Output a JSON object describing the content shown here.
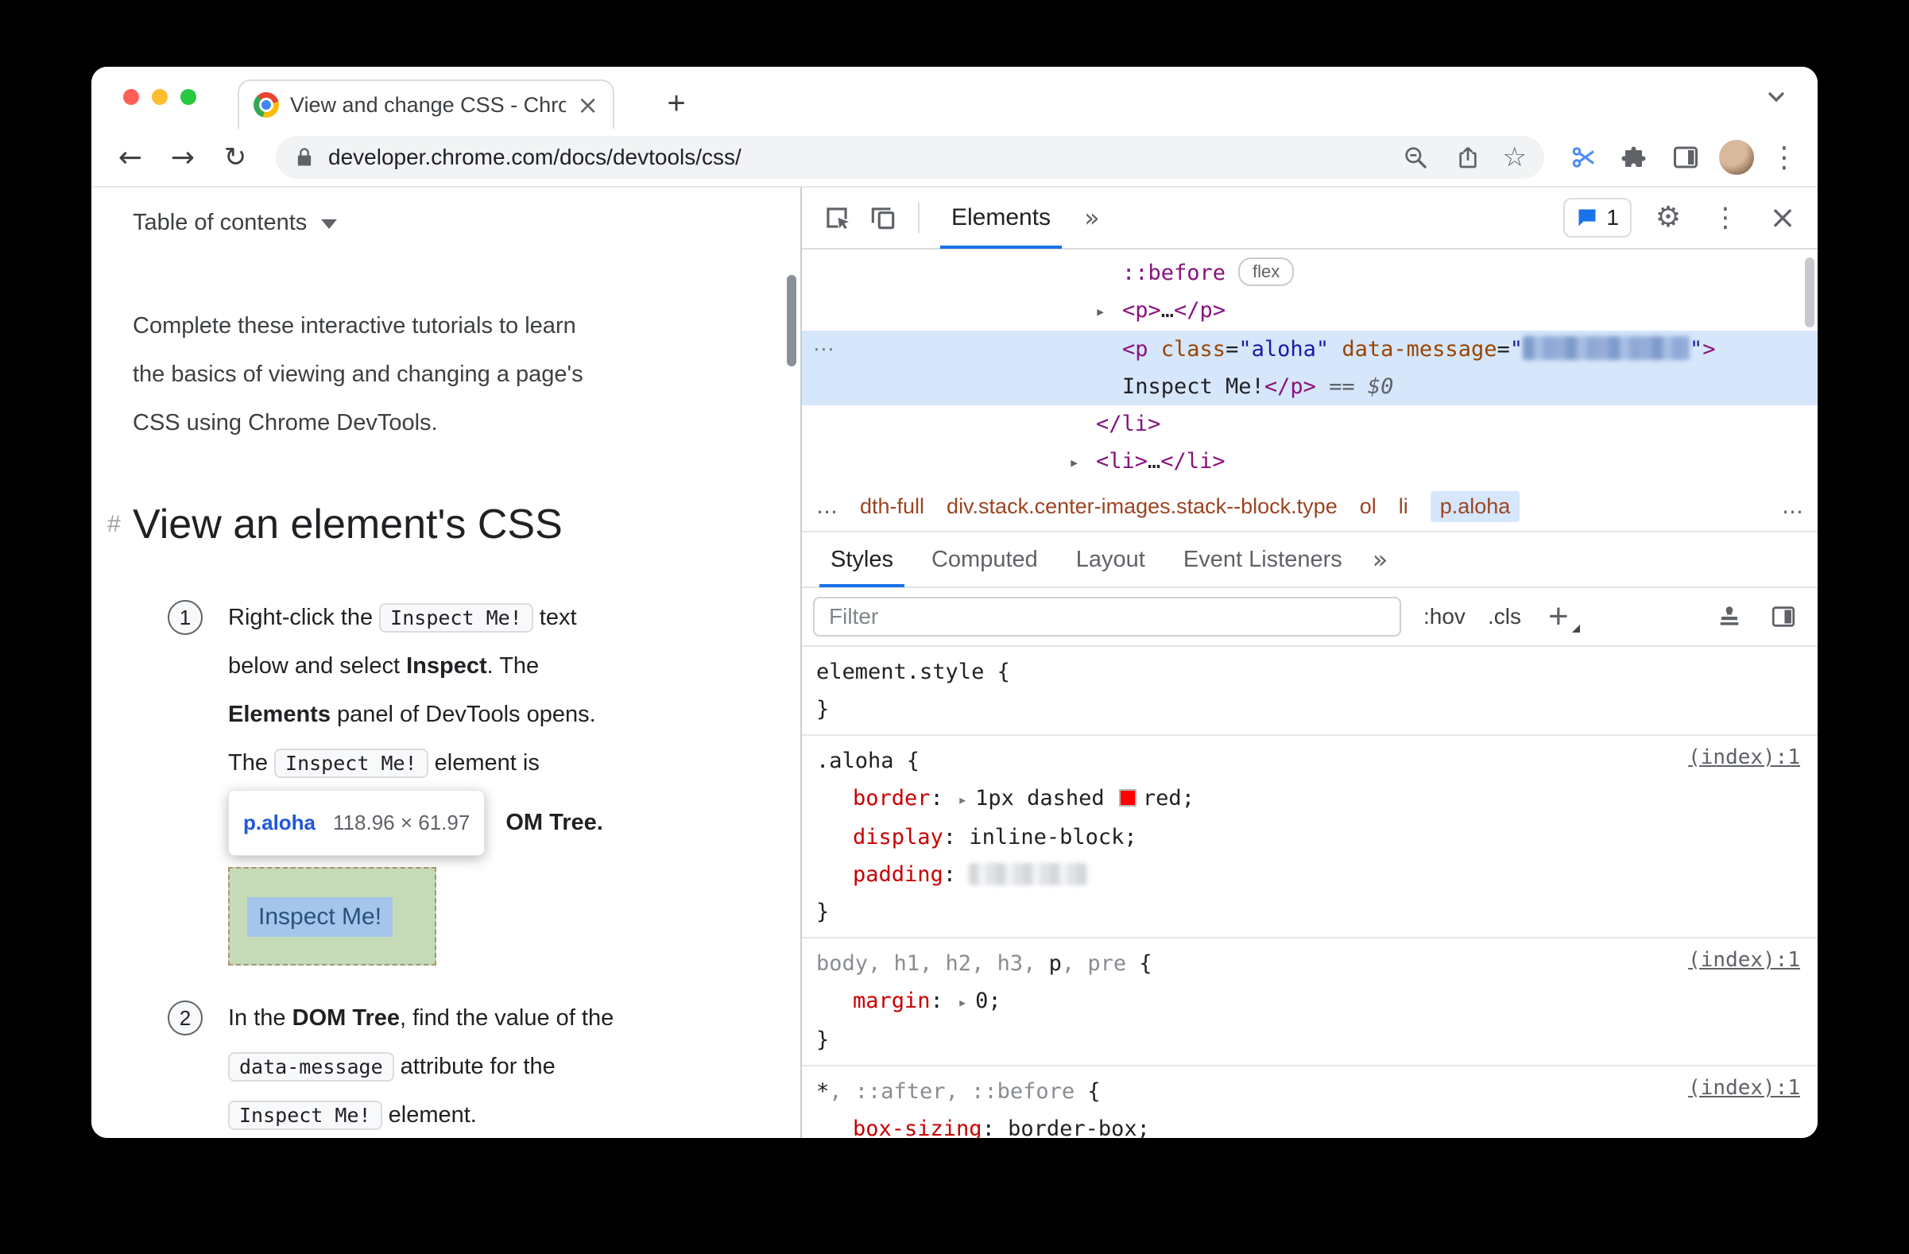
{
  "browser": {
    "tab_title": "View and change CSS - Chrom",
    "url": "developer.chrome.com/docs/devtools/css/",
    "icons": {
      "back": "←",
      "forward": "→",
      "reload": "↻",
      "star": "☆",
      "tab_close": "×",
      "new_tab": "+",
      "menu": "⋮"
    }
  },
  "docs": {
    "toc_label": "Table of contents",
    "intro_lines": [
      "Complete these interactive tutorials to learn",
      "the basics of viewing and changing a page's",
      "CSS using Chrome DevTools."
    ],
    "heading_anchor": "#",
    "heading": "View an element's CSS",
    "steps": {
      "one": {
        "num": "1",
        "lines": [
          [
            {
              "t": "text",
              "v": "Right-click the "
            },
            {
              "t": "code",
              "v": "Inspect Me!"
            },
            {
              "t": "text",
              "v": " text"
            }
          ],
          [
            {
              "t": "text",
              "v": "below and select "
            },
            {
              "t": "bold",
              "v": "Inspect"
            },
            {
              "t": "text",
              "v": ". The"
            }
          ],
          [
            {
              "t": "bold",
              "v": "Elements"
            },
            {
              "t": "text",
              "v": " panel of DevTools opens."
            }
          ],
          [
            {
              "t": "text",
              "v": "The "
            },
            {
              "t": "code",
              "v": "Inspect Me!"
            },
            {
              "t": "text",
              "v": " element is"
            }
          ]
        ],
        "tail": "OM Tree."
      },
      "two": {
        "num": "2",
        "lines": [
          [
            {
              "t": "text",
              "v": "In the "
            },
            {
              "t": "bold",
              "v": "DOM Tree"
            },
            {
              "t": "text",
              "v": ", find the value of the"
            }
          ],
          [
            {
              "t": "code",
              "v": "data-message"
            },
            {
              "t": "text",
              "v": " attribute for the"
            }
          ],
          [
            {
              "t": "code",
              "v": "Inspect Me!"
            },
            {
              "t": "text",
              "v": " element."
            }
          ]
        ]
      }
    },
    "tooltip": {
      "selector": "p.aloha",
      "size": "118.96 × 61.97"
    },
    "inspect_me_label": "Inspect Me!"
  },
  "devtools": {
    "toolbar": {
      "elements_tab": "Elements",
      "more": "»",
      "issues_count": "1",
      "gear": "⚙",
      "menu": "⋮",
      "close": "×"
    },
    "dom_rows": [
      {
        "level": 2,
        "tokens": [
          {
            "c": "pseudo",
            "v": "::before"
          },
          {
            "c": "badge",
            "v": "flex"
          }
        ]
      },
      {
        "level": 2,
        "arrow": "▸",
        "tokens": [
          {
            "c": "tag",
            "v": "<p>"
          },
          {
            "c": "plain",
            "v": "…"
          },
          {
            "c": "tag",
            "v": "</p>"
          }
        ]
      },
      {
        "level": 2,
        "selected": true,
        "gutter": "⋯",
        "tokens": [
          {
            "c": "tag",
            "v": "<p "
          },
          {
            "c": "attr",
            "v": "class"
          },
          {
            "c": "plain",
            "v": "="
          },
          {
            "c": "val",
            "v": "\"aloha\""
          },
          {
            "c": "plain",
            "v": " "
          },
          {
            "c": "attr",
            "v": "data-message"
          },
          {
            "c": "plain",
            "v": "="
          },
          {
            "c": "val",
            "v": "\""
          },
          {
            "c": "redact-blue",
            "v": ""
          },
          {
            "c": "val",
            "v": "\""
          },
          {
            "c": "tag",
            "v": ">"
          }
        ],
        "tokens2": [
          {
            "c": "text",
            "v": "Inspect Me!"
          },
          {
            "c": "tag",
            "v": "</p>"
          },
          {
            "c": "dim",
            "v": " == "
          },
          {
            "c": "dim-italic",
            "v": "$0"
          }
        ]
      },
      {
        "level": 1,
        "tokens": [
          {
            "c": "tag",
            "v": "</li>"
          }
        ]
      },
      {
        "level": 1,
        "arrow": "▸",
        "tokens": [
          {
            "c": "tag",
            "v": "<li>"
          },
          {
            "c": "plain",
            "v": "…"
          },
          {
            "c": "tag",
            "v": "</li>"
          }
        ]
      }
    ],
    "breadcrumbs": {
      "lead": "…",
      "items": [
        {
          "label": "dth-full"
        },
        {
          "label": "div.stack.center-images.stack--block.type"
        },
        {
          "label": "ol"
        },
        {
          "label": "li"
        },
        {
          "label": "p.aloha",
          "selected": true
        }
      ],
      "trail": "…"
    },
    "style_tabs": [
      {
        "label": "Styles",
        "active": true
      },
      {
        "label": "Computed"
      },
      {
        "label": "Layout"
      },
      {
        "label": "Event Listeners"
      }
    ],
    "style_tabs_more": "»",
    "filter": {
      "placeholder": "Filter",
      "hov_label": ":hov",
      "cls_label": ".cls",
      "plus": "+"
    },
    "style_sections": [
      {
        "lines": [
          {
            "tokens": [
              {
                "c": "sel",
                "v": "element.style"
              },
              {
                "c": "plain",
                "v": " {"
              }
            ]
          },
          {
            "tokens": [
              {
                "c": "plain",
                "v": "}"
              }
            ]
          }
        ]
      },
      {
        "link": "(index):1",
        "lines": [
          {
            "tokens": [
              {
                "c": "sel",
                "v": ".aloha"
              },
              {
                "c": "plain",
                "v": " {"
              }
            ]
          },
          {
            "prop": true,
            "tokens": [
              {
                "c": "prop",
                "v": "border"
              },
              {
                "c": "plain",
                "v": ": "
              },
              {
                "c": "exp",
                "v": "▸"
              },
              {
                "c": "plain",
                "v": "1px dashed "
              },
              {
                "c": "swatch",
                "v": ""
              },
              {
                "c": "plain",
                "v": "red;"
              }
            ]
          },
          {
            "prop": true,
            "tokens": [
              {
                "c": "prop",
                "v": "display"
              },
              {
                "c": "plain",
                "v": ": inline-block;"
              }
            ]
          },
          {
            "prop": true,
            "tokens": [
              {
                "c": "prop",
                "v": "padding"
              },
              {
                "c": "plain",
                "v": ": "
              },
              {
                "c": "redact-gray",
                "v": ""
              }
            ]
          },
          {
            "tokens": [
              {
                "c": "plain",
                "v": "}"
              }
            ]
          }
        ]
      },
      {
        "link": "(index):1",
        "lines": [
          {
            "tokens": [
              {
                "c": "dimsel",
                "v": "body, h1, h2, h3, "
              },
              {
                "c": "sel",
                "v": "p"
              },
              {
                "c": "dimsel",
                "v": ", pre"
              },
              {
                "c": "plain",
                "v": " {"
              }
            ]
          },
          {
            "prop": true,
            "tokens": [
              {
                "c": "prop",
                "v": "margin"
              },
              {
                "c": "plain",
                "v": ": "
              },
              {
                "c": "exp",
                "v": "▸"
              },
              {
                "c": "plain",
                "v": "0;"
              }
            ]
          },
          {
            "tokens": [
              {
                "c": "plain",
                "v": "}"
              }
            ]
          }
        ]
      },
      {
        "link": "(index):1",
        "lines": [
          {
            "tokens": [
              {
                "c": "sel",
                "v": "*"
              },
              {
                "c": "dimsel",
                "v": ", ::after, ::before"
              },
              {
                "c": "plain",
                "v": " {"
              }
            ]
          },
          {
            "prop": true,
            "tokens": [
              {
                "c": "prop",
                "v": "box-sizing"
              },
              {
                "c": "plain",
                "v": ": border-box;"
              }
            ]
          }
        ]
      }
    ]
  }
}
